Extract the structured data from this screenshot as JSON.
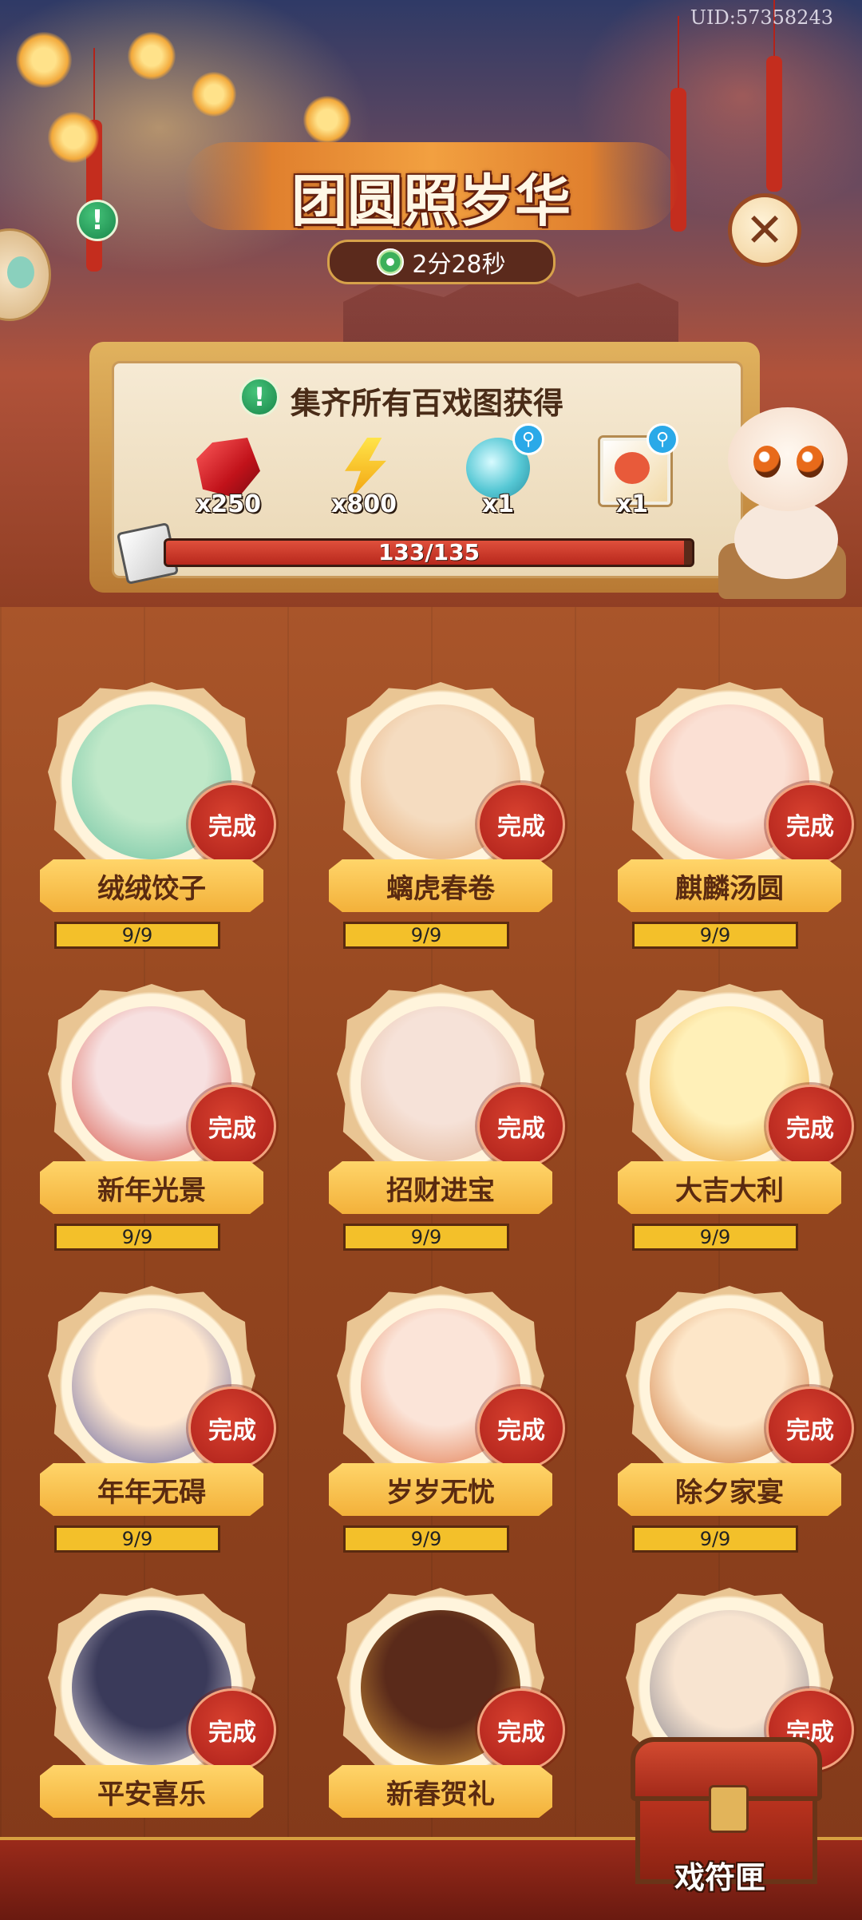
{
  "uid": "UID:57358243",
  "title": "团圆照岁华",
  "timer": "2分28秒",
  "panel": {
    "heading": "集齐所有百戏图获得",
    "rewards": [
      {
        "icon": "red-gem-icon",
        "qty": "x250"
      },
      {
        "icon": "lightning-icon",
        "qty": "x800"
      },
      {
        "icon": "cloud-orb-icon",
        "qty": "x1"
      },
      {
        "icon": "portrait-card-icon",
        "qty": "x1"
      }
    ],
    "progress_text": "133/135",
    "progress_fraction": 0.985
  },
  "items": [
    {
      "name": "绒绒饺子",
      "status": "完成",
      "count": "9/9"
    },
    {
      "name": "螭虎春卷",
      "status": "完成",
      "count": "9/9"
    },
    {
      "name": "麒麟汤圆",
      "status": "完成",
      "count": "9/9"
    },
    {
      "name": "新年光景",
      "status": "完成",
      "count": "9/9"
    },
    {
      "name": "招财进宝",
      "status": "完成",
      "count": "9/9"
    },
    {
      "name": "大吉大利",
      "status": "完成",
      "count": "9/9"
    },
    {
      "name": "年年无碍",
      "status": "完成",
      "count": "9/9"
    },
    {
      "name": "岁岁无忧",
      "status": "完成",
      "count": "9/9"
    },
    {
      "name": "除夕家宴",
      "status": "完成",
      "count": "9/9"
    },
    {
      "name": "平安喜乐",
      "status": "完成",
      "count": ""
    },
    {
      "name": "新春贺礼",
      "status": "完成",
      "count": ""
    },
    {
      "name": "",
      "status": "完成",
      "count": ""
    }
  ],
  "chest_label": "戏符匣",
  "colors": {
    "accent_gold": "#f3b13a",
    "badge_red": "#c42d22",
    "progress_red": "#c8301e"
  }
}
